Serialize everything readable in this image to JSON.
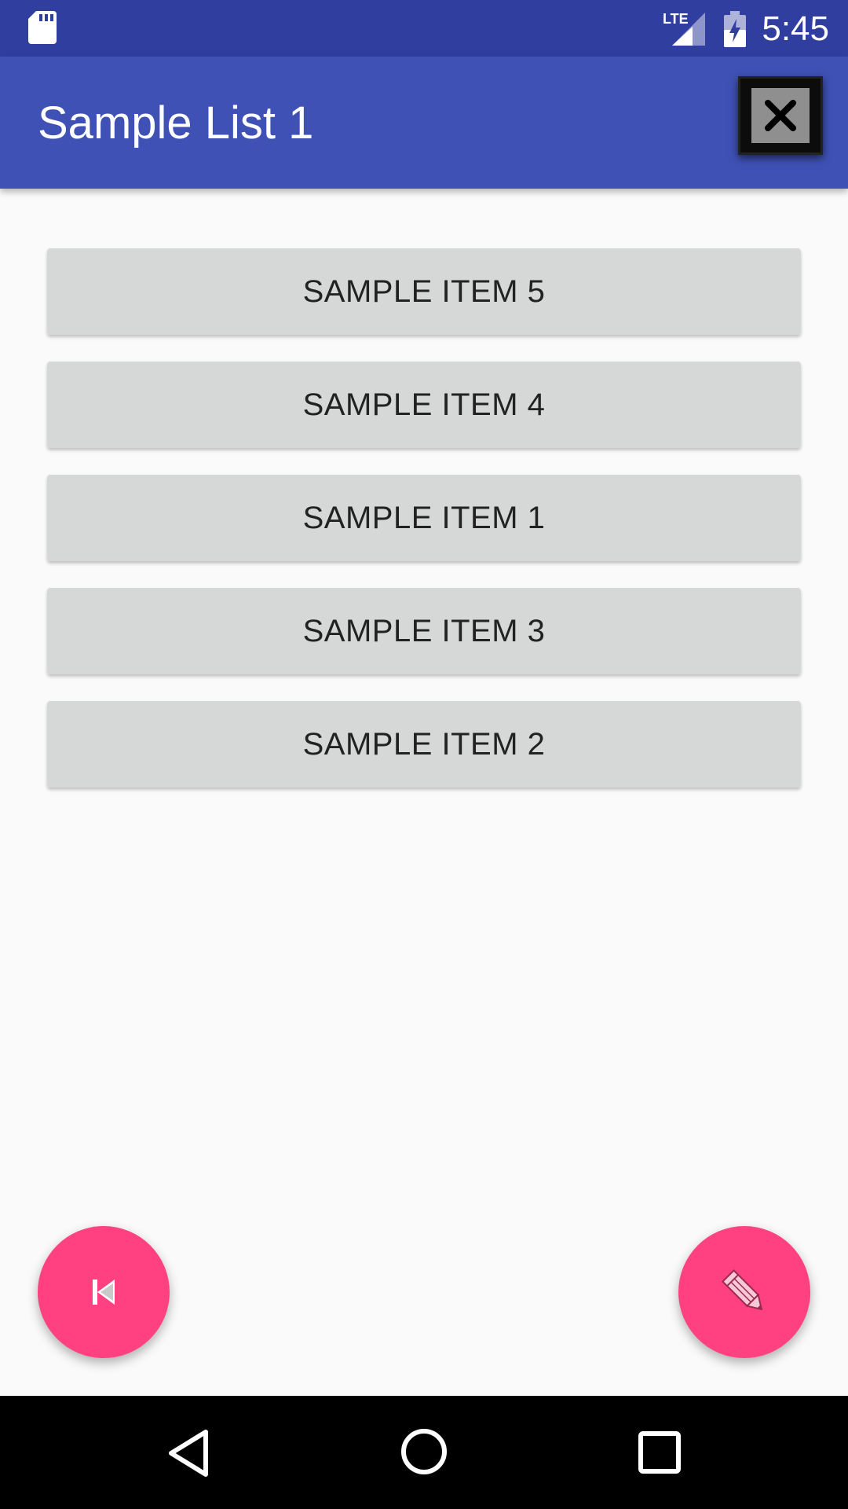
{
  "status_bar": {
    "time": "5:45",
    "network_label": "LTE",
    "icons": [
      "sd-card-icon",
      "lte-signal-icon",
      "battery-charging-icon"
    ]
  },
  "app_bar": {
    "title": "Sample List 1",
    "close_icon": "close-icon"
  },
  "list": {
    "items": [
      {
        "label": "SAMPLE ITEM 5"
      },
      {
        "label": "SAMPLE ITEM 4"
      },
      {
        "label": "SAMPLE ITEM 1"
      },
      {
        "label": "SAMPLE ITEM 3"
      },
      {
        "label": "SAMPLE ITEM 2"
      }
    ]
  },
  "fabs": {
    "left_icon": "skip-previous-icon",
    "right_icon": "pencil-icon"
  },
  "nav_bar": {
    "icons": [
      "back-icon",
      "home-icon",
      "recents-icon"
    ]
  },
  "colors": {
    "status_bar": "#303f9f",
    "app_bar": "#3f51b5",
    "accent": "#ff4081",
    "list_item_bg": "#d6d7d7",
    "background": "#fafafa"
  }
}
